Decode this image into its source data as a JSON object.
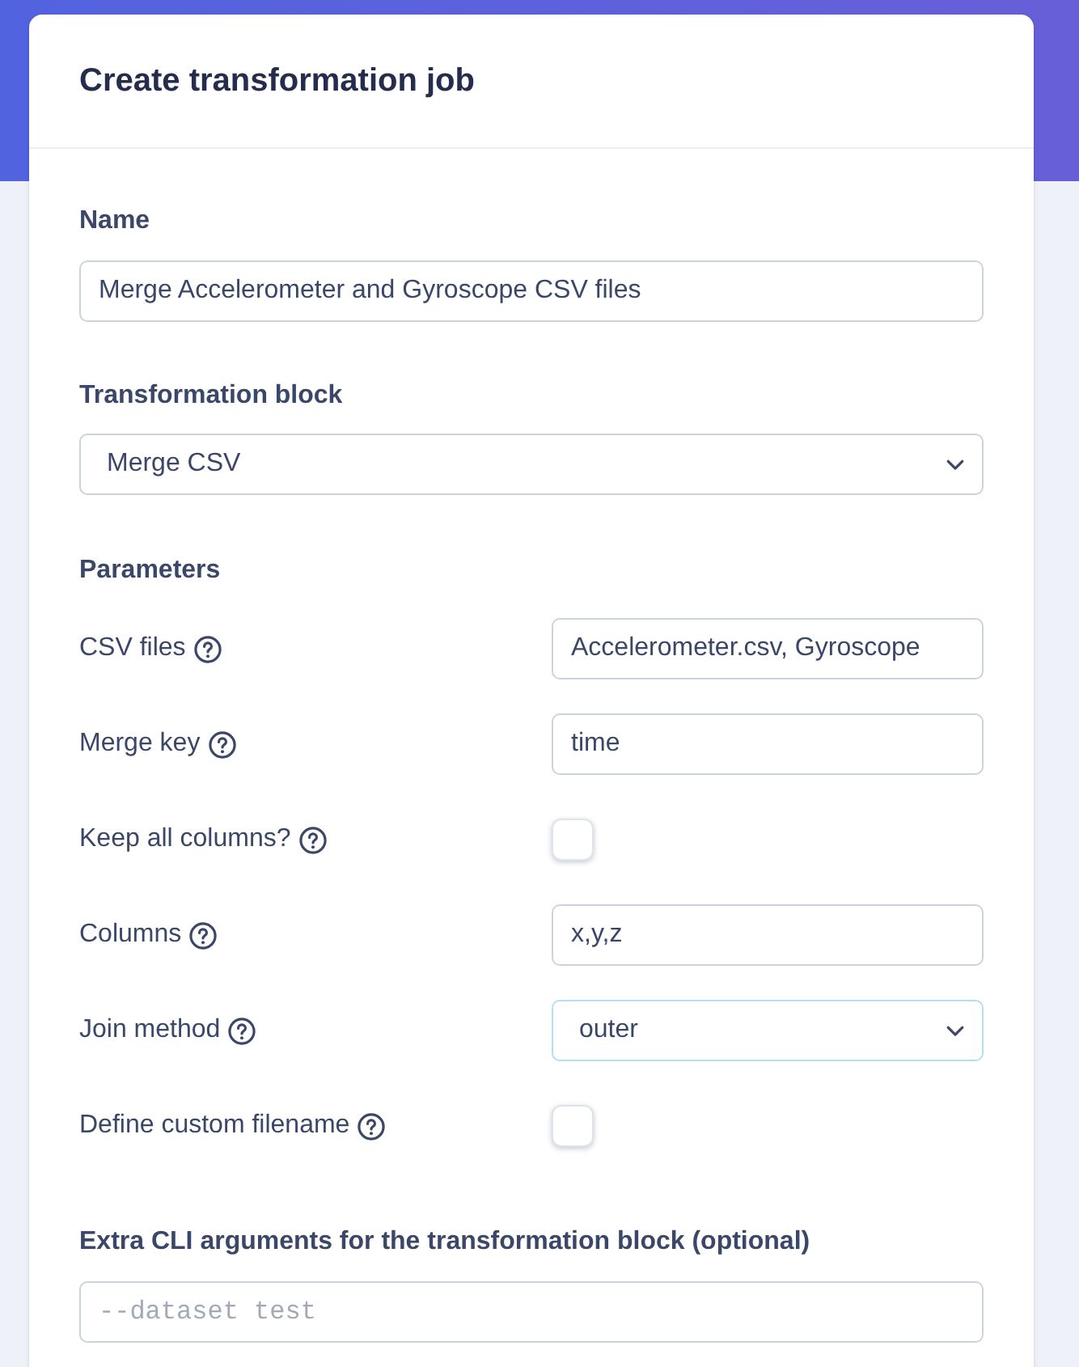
{
  "dialog": {
    "title": "Create transformation job"
  },
  "name_field": {
    "label": "Name",
    "value": "Merge Accelerometer and Gyroscope CSV files"
  },
  "transformation_block": {
    "label": "Transformation block",
    "value": "Merge CSV"
  },
  "parameters": {
    "heading": "Parameters",
    "items": [
      {
        "kind": "text",
        "label": "CSV files",
        "value": "Accelerometer.csv, Gyroscope"
      },
      {
        "kind": "text",
        "label": "Merge key",
        "value": "time"
      },
      {
        "kind": "checkbox",
        "label": "Keep all columns?",
        "checked": false
      },
      {
        "kind": "text",
        "label": "Columns",
        "value": "x,y,z"
      },
      {
        "kind": "select",
        "label": "Join method",
        "value": "outer",
        "focused": true
      },
      {
        "kind": "checkbox",
        "label": "Define custom filename",
        "checked": false
      }
    ]
  },
  "extra_cli": {
    "label": "Extra CLI arguments for the transformation block (optional)",
    "placeholder": "--dataset test"
  }
}
